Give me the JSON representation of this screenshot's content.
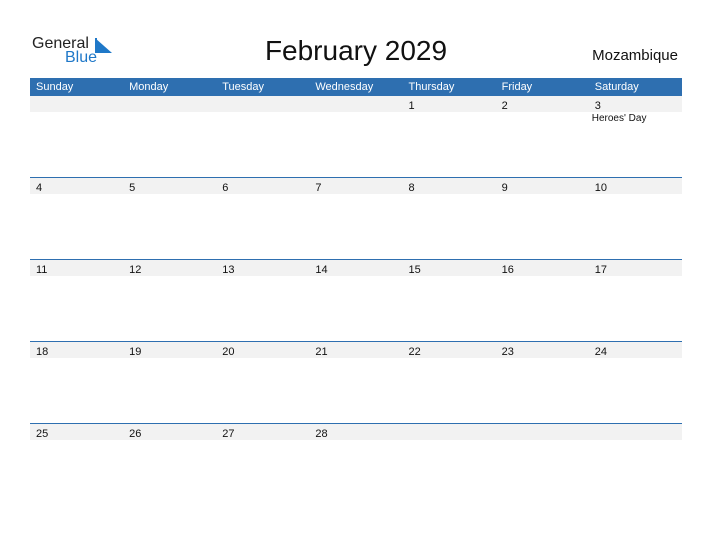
{
  "logo": {
    "line1": "General",
    "line2": "Blue",
    "icon": "triangle-flag-icon",
    "accent": "#1f78c8"
  },
  "title": "February 2029",
  "country": "Mozambique",
  "header_color": "#2e6fb0",
  "weekdays": [
    "Sunday",
    "Monday",
    "Tuesday",
    "Wednesday",
    "Thursday",
    "Friday",
    "Saturday"
  ],
  "weeks": [
    [
      {
        "d": ""
      },
      {
        "d": ""
      },
      {
        "d": ""
      },
      {
        "d": ""
      },
      {
        "d": "1"
      },
      {
        "d": "2"
      },
      {
        "d": "3",
        "event": "Heroes' Day"
      }
    ],
    [
      {
        "d": "4"
      },
      {
        "d": "5"
      },
      {
        "d": "6"
      },
      {
        "d": "7"
      },
      {
        "d": "8"
      },
      {
        "d": "9"
      },
      {
        "d": "10"
      }
    ],
    [
      {
        "d": "11"
      },
      {
        "d": "12"
      },
      {
        "d": "13"
      },
      {
        "d": "14"
      },
      {
        "d": "15"
      },
      {
        "d": "16"
      },
      {
        "d": "17"
      }
    ],
    [
      {
        "d": "18"
      },
      {
        "d": "19"
      },
      {
        "d": "20"
      },
      {
        "d": "21"
      },
      {
        "d": "22"
      },
      {
        "d": "23"
      },
      {
        "d": "24"
      }
    ],
    [
      {
        "d": "25"
      },
      {
        "d": "26"
      },
      {
        "d": "27"
      },
      {
        "d": "28"
      },
      {
        "d": ""
      },
      {
        "d": ""
      },
      {
        "d": ""
      }
    ]
  ]
}
